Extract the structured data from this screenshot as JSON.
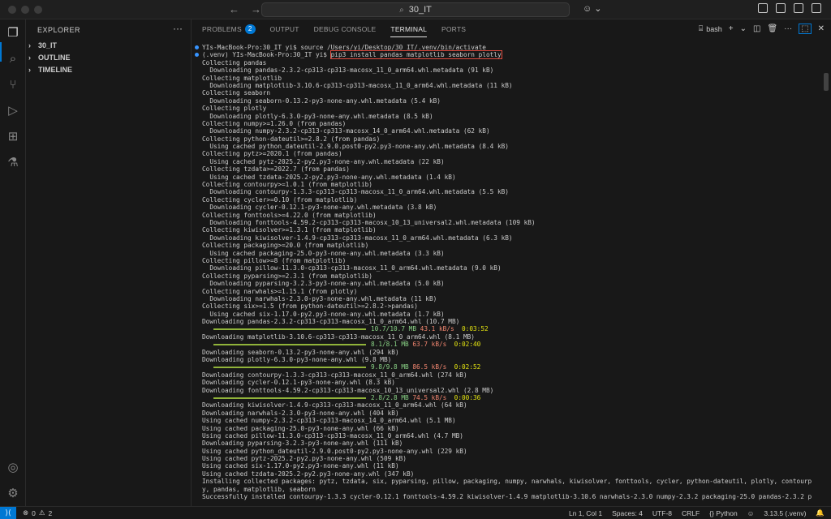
{
  "title_bar": {
    "search_text": "30_IT",
    "search_icon": "search-icon",
    "copilot_icon": "copilot-icon"
  },
  "activity_bar": {
    "items": [
      {
        "name": "explorer-icon",
        "glyph": "❐"
      },
      {
        "name": "search-icon",
        "glyph": "⌕"
      },
      {
        "name": "source-control-icon",
        "glyph": "⑂"
      },
      {
        "name": "run-debug-icon",
        "glyph": "▷"
      },
      {
        "name": "extensions-icon",
        "glyph": "⊞"
      },
      {
        "name": "testing-icon",
        "glyph": "⚗"
      }
    ],
    "bottom_items": [
      {
        "name": "account-icon",
        "glyph": "◎"
      },
      {
        "name": "settings-gear-icon",
        "glyph": "⚙"
      }
    ]
  },
  "sidebar": {
    "header": "EXPLORER",
    "more": "···",
    "sections": [
      "30_IT",
      "OUTLINE",
      "TIMELINE"
    ]
  },
  "panel": {
    "tabs": [
      {
        "label": "PROBLEMS",
        "badge": "2"
      },
      {
        "label": "OUTPUT"
      },
      {
        "label": "DEBUG CONSOLE"
      },
      {
        "label": "TERMINAL"
      },
      {
        "label": "PORTS"
      }
    ],
    "terminal_name": "bash",
    "add_label": "+",
    "terminal_lines": [
      "YIs-MacBook-Pro:30_IT yi$ source /Users/yi/Desktop/30_IT/.venv/bin/activate",
      "(.venv) YIs-MacBook-Pro:30_IT yi$ ",
      "Collecting pandas",
      "  Downloading pandas-2.3.2-cp313-cp313-macosx_11_0_arm64.whl.metadata (91 kB)",
      "Collecting matplotlib",
      "  Downloading matplotlib-3.10.6-cp313-cp313-macosx_11_0_arm64.whl.metadata (11 kB)",
      "Collecting seaborn",
      "  Downloading seaborn-0.13.2-py3-none-any.whl.metadata (5.4 kB)",
      "Collecting plotly",
      "  Downloading plotly-6.3.0-py3-none-any.whl.metadata (8.5 kB)",
      "Collecting numpy>=1.26.0 (from pandas)",
      "  Downloading numpy-2.3.2-cp313-cp313-macosx_14_0_arm64.whl.metadata (62 kB)",
      "Collecting python-dateutil>=2.8.2 (from pandas)",
      "  Using cached python_dateutil-2.9.0.post0-py2.py3-none-any.whl.metadata (8.4 kB)",
      "Collecting pytz>=2020.1 (from pandas)",
      "  Using cached pytz-2025.2-py2.py3-none-any.whl.metadata (22 kB)",
      "Collecting tzdata>=2022.7 (from pandas)",
      "  Using cached tzdata-2025.2-py2.py3-none-any.whl.metadata (1.4 kB)",
      "Collecting contourpy>=1.0.1 (from matplotlib)",
      "  Downloading contourpy-1.3.3-cp313-cp313-macosx_11_0_arm64.whl.metadata (5.5 kB)",
      "Collecting cycler>=0.10 (from matplotlib)",
      "  Downloading cycler-0.12.1-py3-none-any.whl.metadata (3.8 kB)",
      "Collecting fonttools>=4.22.0 (from matplotlib)",
      "  Downloading fonttools-4.59.2-cp313-cp313-macosx_10_13_universal2.whl.metadata (109 kB)",
      "Collecting kiwisolver>=1.3.1 (from matplotlib)",
      "  Downloading kiwisolver-1.4.9-cp313-cp313-macosx_11_0_arm64.whl.metadata (6.3 kB)",
      "Collecting packaging>=20.0 (from matplotlib)",
      "  Using cached packaging-25.0-py3-none-any.whl.metadata (3.3 kB)",
      "Collecting pillow>=8 (from matplotlib)",
      "  Downloading pillow-11.3.0-cp313-cp313-macosx_11_0_arm64.whl.metadata (9.0 kB)",
      "Collecting pyparsing>=2.3.1 (from matplotlib)",
      "  Downloading pyparsing-3.2.3-py3-none-any.whl.metadata (5.0 kB)",
      "Collecting narwhals>=1.15.1 (from plotly)",
      "  Downloading narwhals-2.3.0-py3-none-any.whl.metadata (11 kB)",
      "Collecting six>=1.5 (from python-dateutil>=2.8.2->pandas)",
      "  Using cached six-1.17.0-py2.py3-none-any.whl.metadata (1.7 kB)",
      "Downloading pandas-2.3.2-cp313-cp313-macosx_11_0_arm64.whl (10.7 MB)",
      "Downloading matplotlib-3.10.6-cp313-cp313-macosx_11_0_arm64.whl (8.1 MB)",
      "Downloading seaborn-0.13.2-py3-none-any.whl (294 kB)",
      "Downloading plotly-6.3.0-py3-none-any.whl (9.8 MB)",
      "Downloading contourpy-1.3.3-cp313-cp313-macosx_11_0_arm64.whl (274 kB)",
      "Downloading cycler-0.12.1-py3-none-any.whl (8.3 kB)",
      "Downloading fonttools-4.59.2-cp313-cp313-macosx_10_13_universal2.whl (2.8 MB)",
      "Downloading kiwisolver-1.4.9-cp313-cp313-macosx_11_0_arm64.whl (64 kB)",
      "Downloading narwhals-2.3.0-py3-none-any.whl (404 kB)",
      "Using cached numpy-2.3.2-cp313-cp313-macosx_14_0_arm64.whl (5.1 MB)",
      "Using cached packaging-25.0-py3-none-any.whl (66 kB)",
      "Using cached pillow-11.3.0-cp313-cp313-macosx_11_0_arm64.whl (4.7 MB)",
      "Downloading pyparsing-3.2.3-py3-none-any.whl (111 kB)",
      "Using cached python_dateutil-2.9.0.post0-py2.py3-none-any.whl (229 kB)",
      "Using cached pytz-2025.2-py2.py3-none-any.whl (509 kB)",
      "Using cached six-1.17.0-py2.py3-none-any.whl (11 kB)",
      "Using cached tzdata-2025.2-py2.py3-none-any.whl (347 kB)",
      "Installing collected packages: pytz, tzdata, six, pyparsing, pillow, packaging, numpy, narwhals, kiwisolver, fonttools, cycler, python-dateutil, plotly, contourp",
      "y, pandas, matplotlib, seaborn",
      "Successfully installed contourpy-1.3.3 cycler-0.12.1 fonttools-4.59.2 kiwisolver-1.4.9 matplotlib-3.10.6 narwhals-2.3.0 numpy-2.3.2 packaging-25.0 pandas-2.3.2 p"
    ],
    "highlighted_command": "pip3 install pandas matplotlib seaborn plotly",
    "progress": [
      {
        "size": "10.7/10.7 MB",
        "rate": "43.1 kB/s",
        "eta": "0:03:52",
        "fraction": 1.0
      },
      {
        "size": "8.1/8.1 MB",
        "rate": "63.7 kB/s",
        "eta": "0:02:40",
        "fraction": 1.0
      },
      {
        "size": "9.8/9.8 MB",
        "rate": "86.5 kB/s",
        "eta": "0:02:52",
        "fraction": 1.0
      },
      {
        "size": "2.8/2.8 MB",
        "rate": "74.5 kB/s",
        "eta": "0:00:36",
        "fraction": 1.0
      }
    ]
  },
  "status_bar": {
    "errors": "0",
    "warnings": "2",
    "position": "Ln 1, Col 1",
    "spaces": "Spaces: 4",
    "encoding": "UTF-8",
    "eol": "CRLF",
    "language": "{} Python",
    "interpreter": "3.13.5 (.venv)"
  },
  "colors": {
    "accent": "#0078d4",
    "progress_bar": "#90b33a",
    "highlight_border": "#e04b3f"
  }
}
